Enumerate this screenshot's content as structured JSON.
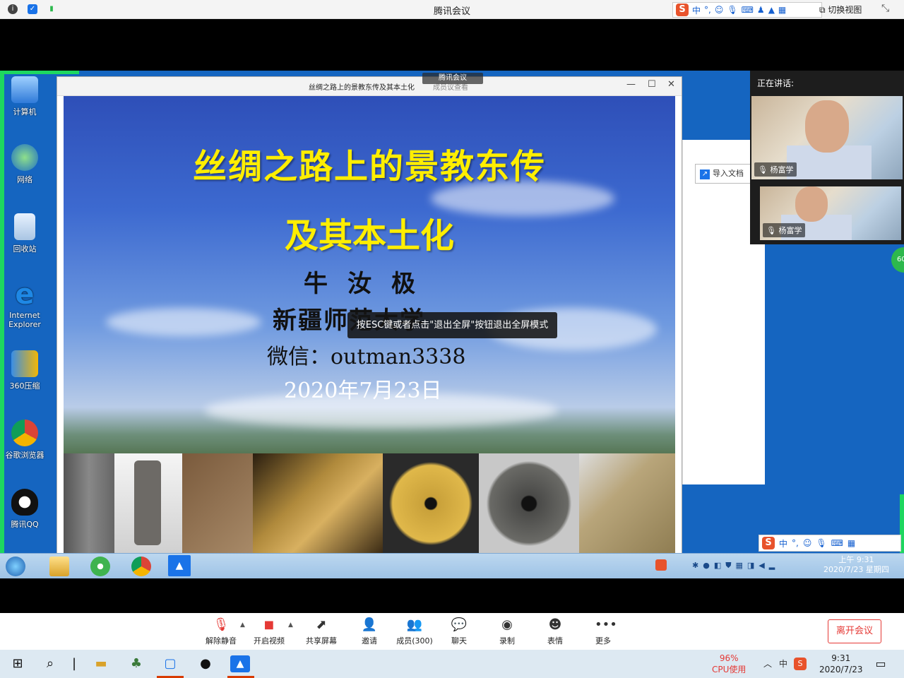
{
  "titlebar": {
    "title": "腾讯会议",
    "switch_view": "切换视图"
  },
  "ime": {
    "lang": "中",
    "punct": "°,"
  },
  "shared": {
    "desktop_icons": [
      {
        "label": "计算机"
      },
      {
        "label": "网络"
      },
      {
        "label": "回收站"
      },
      {
        "label": "Internet Explorer"
      },
      {
        "label": "360压缩"
      },
      {
        "label": "谷歌浏览器"
      },
      {
        "label": "腾讯QQ"
      }
    ],
    "inner_window": {
      "title": "丝绸之路上的景教东传及其本土化",
      "subtitle": "成员议查看"
    },
    "meeting_mini": "腾讯会议",
    "slide": {
      "title_line1": "丝绸之路上的景教东传",
      "title_line2": "及其本土化",
      "author": "牛汝极",
      "school": "新疆师范大学",
      "wechat": "微信：outman3338",
      "date": "2020年7月23日"
    },
    "esc_tip": "按ESC键或者点击\"退出全屏\"按钮退出全屏模式",
    "import_doc": "导入文档",
    "inner_clock": {
      "time": "上午 9:31",
      "date": "2020/7/23 星期四"
    },
    "green_badge": "60"
  },
  "speaking": {
    "label": "正在讲话:",
    "videos": [
      {
        "name": "杨富学"
      },
      {
        "name": "杨富学"
      }
    ]
  },
  "toolbar": {
    "items": [
      {
        "label": "解除静音",
        "icon": "mic-muted-icon"
      },
      {
        "label": "开启视频",
        "icon": "camera-off-icon"
      },
      {
        "label": "共享屏幕",
        "icon": "share-screen-icon"
      },
      {
        "label": "邀请",
        "icon": "invite-icon"
      },
      {
        "label": "成员(300)",
        "icon": "members-icon"
      },
      {
        "label": "聊天",
        "icon": "chat-icon"
      },
      {
        "label": "录制",
        "icon": "record-icon"
      },
      {
        "label": "表情",
        "icon": "emoji-icon"
      },
      {
        "label": "更多",
        "icon": "more-icon"
      }
    ],
    "leave": "离开会议"
  },
  "taskbar": {
    "cpu_pct": "96%",
    "cpu_label": "CPU使用",
    "ime": "中",
    "time": "9:31",
    "date": "2020/7/23"
  }
}
